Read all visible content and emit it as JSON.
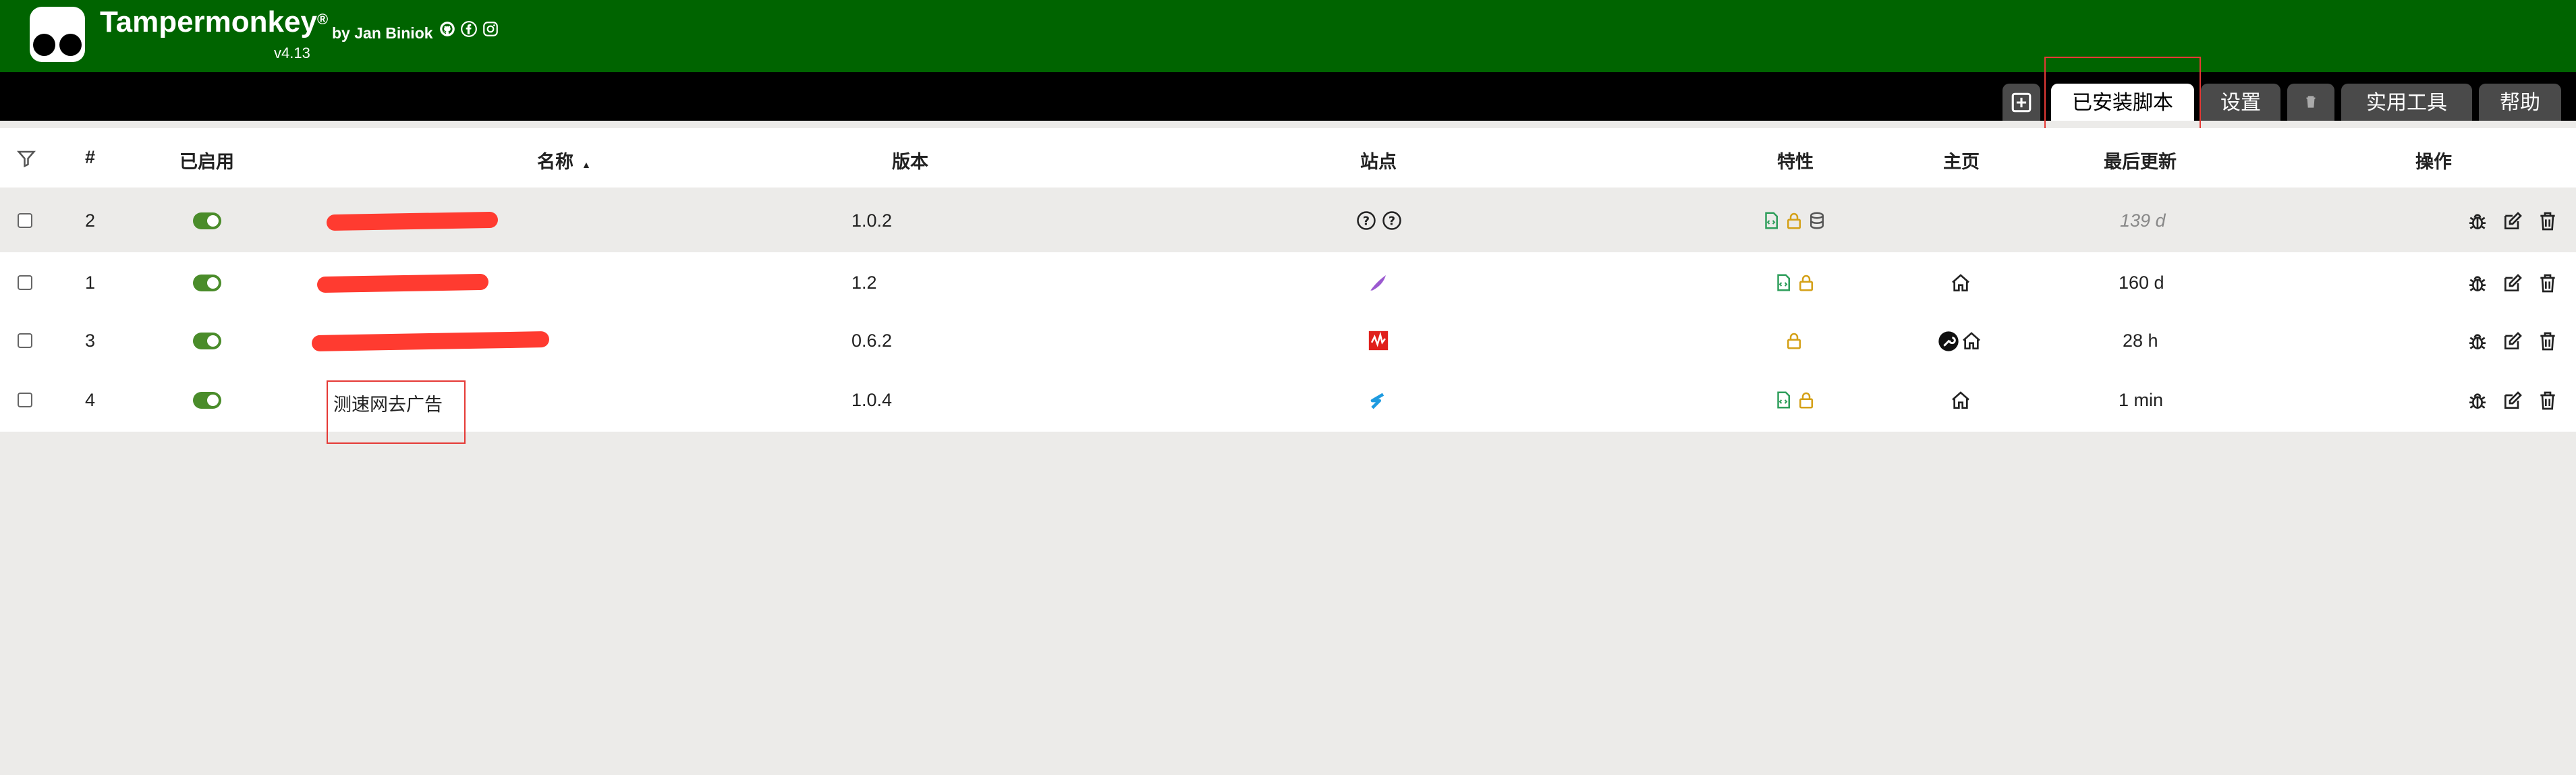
{
  "app": {
    "name": "Tampermonkey",
    "registered": "®",
    "by": "by Jan Biniok",
    "version": "v4.13",
    "social_icons": [
      "github-icon",
      "facebook-icon",
      "instagram-icon"
    ]
  },
  "tabs": [
    {
      "label": "",
      "icon": "plus-square-icon"
    },
    {
      "label": "已安装脚本",
      "active": true
    },
    {
      "label": "设置"
    },
    {
      "label": "",
      "icon": "trash-icon"
    },
    {
      "label": "实用工具"
    },
    {
      "label": "帮助"
    }
  ],
  "table": {
    "columns": {
      "filter": "filter-icon",
      "number": "#",
      "enabled": "已启用",
      "name": "名称",
      "sort_indicator": "▲",
      "version": "版本",
      "sites": "站点",
      "features": "特性",
      "homepage": "主页",
      "last_updated": "最后更新",
      "actions": "操作"
    },
    "rows": [
      {
        "number": "2",
        "enabled": true,
        "name": "",
        "name_redacted": true,
        "version": "1.0.2",
        "sites": [
          "question-circle-icon",
          "question-circle-icon"
        ],
        "features": [
          "script-file-icon",
          "lock-icon",
          "database-icon"
        ],
        "homepage": [],
        "last_updated": "139 d",
        "last_updated_italic": true
      },
      {
        "number": "1",
        "enabled": true,
        "name": "",
        "name_redacted": true,
        "version": "1.2",
        "sites": [
          "purple-feather-favicon"
        ],
        "features": [
          "script-file-icon",
          "lock-icon"
        ],
        "homepage": [
          "home-icon"
        ],
        "last_updated": "160 d"
      },
      {
        "number": "3",
        "enabled": true,
        "name": "",
        "name_redacted": true,
        "version": "0.6.2",
        "sites": [
          "red-site-favicon"
        ],
        "features": [
          "lock-icon"
        ],
        "homepage": [
          "wrench-circle-icon",
          "home-icon"
        ],
        "last_updated": "28 h"
      },
      {
        "number": "4",
        "enabled": true,
        "name": "测速网去广告",
        "name_redacted": false,
        "version": "1.0.4",
        "sites": [
          "blue-s-favicon"
        ],
        "features": [
          "script-file-icon",
          "lock-icon"
        ],
        "homepage": [
          "home-icon"
        ],
        "last_updated": "1 min"
      }
    ],
    "row_actions": [
      "bug-icon",
      "edit-icon",
      "trash-icon"
    ]
  },
  "colors": {
    "header_green": "#006400",
    "toggle_on": "#4a8c2a",
    "feature_green": "#2e9e5b",
    "feature_gold": "#d4a017",
    "highlight_red": "#e53935"
  }
}
